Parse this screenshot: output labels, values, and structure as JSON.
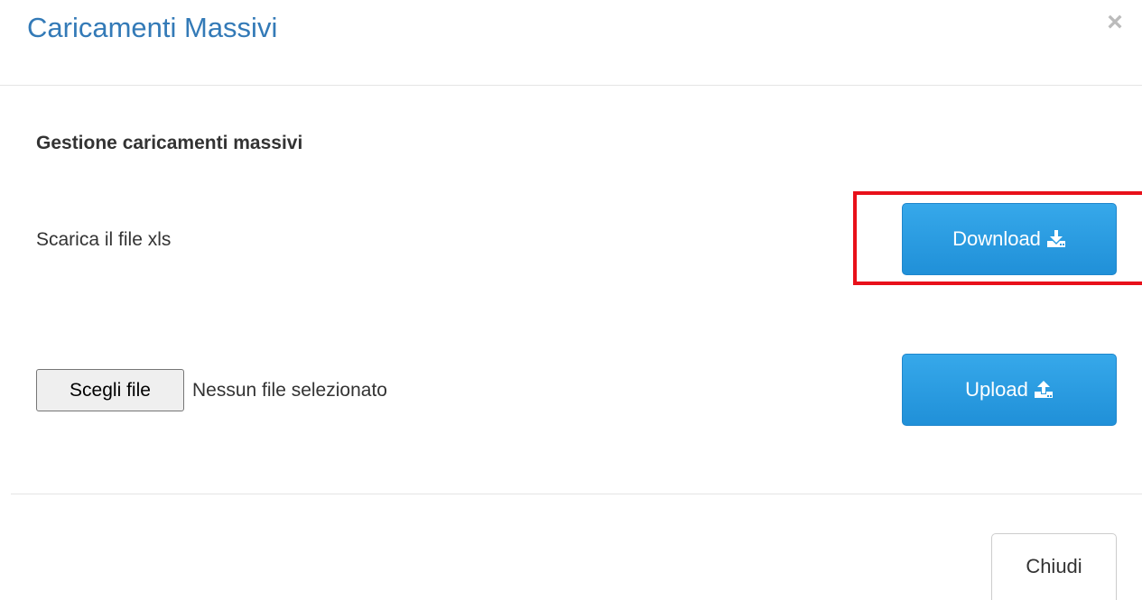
{
  "modal": {
    "title": "Caricamenti Massivi",
    "close_glyph": "×"
  },
  "section": {
    "title": "Gestione caricamenti massivi"
  },
  "download": {
    "label": "Scarica il file xls",
    "button_label": "Download",
    "icon": "download-icon"
  },
  "upload": {
    "file_button_label": "Scegli file",
    "file_status": "Nessun file selezionato",
    "button_label": "Upload",
    "icon": "upload-icon"
  },
  "footer": {
    "close_label": "Chiudi"
  },
  "colors": {
    "title": "#337ab7",
    "primary_button": "#2f9fe0",
    "highlight": "#e8101a"
  }
}
